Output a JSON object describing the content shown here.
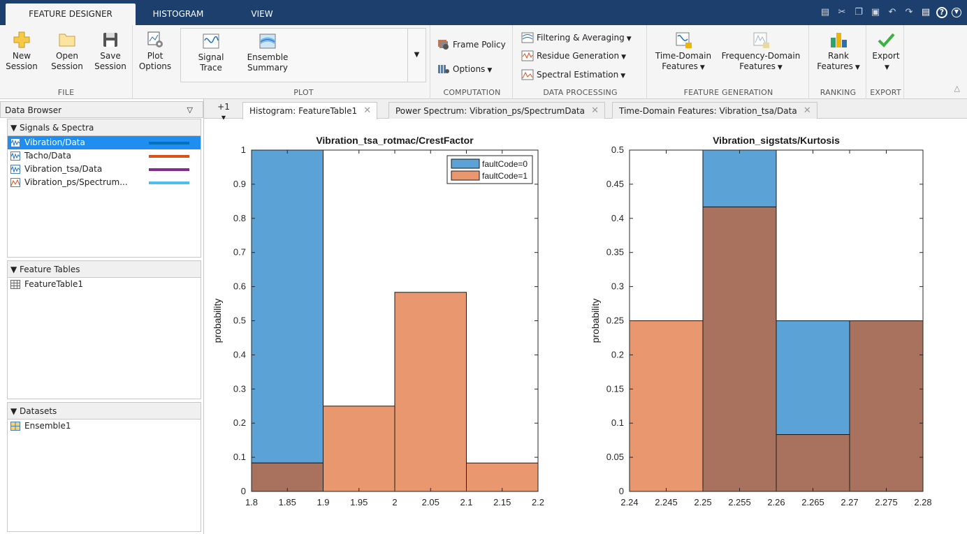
{
  "tabs": [
    {
      "label": "FEATURE DESIGNER",
      "active": true
    },
    {
      "label": "HISTOGRAM",
      "active": false
    },
    {
      "label": "VIEW",
      "active": false
    }
  ],
  "quick_access": [
    "save-icon",
    "cut-icon",
    "copy-icon",
    "paste-icon",
    "undo-icon",
    "redo-icon",
    "layout-icon",
    "help-icon",
    "expand-icon"
  ],
  "ribbon": {
    "file": {
      "name": "FILE",
      "new": [
        "New",
        "Session"
      ],
      "open": [
        "Open",
        "Session"
      ],
      "save": [
        "Save",
        "Session"
      ]
    },
    "plot_options": [
      "Plot",
      "Options"
    ],
    "plot": {
      "name": "PLOT",
      "signal_trace": [
        "Signal",
        "Trace"
      ],
      "ensemble_summary": [
        "Ensemble",
        "Summary"
      ]
    },
    "computation": {
      "name": "COMPUTATION",
      "frame_policy": "Frame Policy",
      "options": "Options"
    },
    "data_processing": {
      "name": "DATA PROCESSING",
      "filtering": "Filtering & Averaging",
      "residue": "Residue Generation",
      "spectral": "Spectral Estimation"
    },
    "feature_generation": {
      "name": "FEATURE GENERATION",
      "time_domain": [
        "Time-Domain",
        "Features"
      ],
      "freq_domain": [
        "Frequency-Domain",
        "Features"
      ]
    },
    "ranking": {
      "name": "RANKING",
      "rank": [
        "Rank",
        "Features"
      ]
    },
    "export": {
      "name": "EXPORT",
      "export": "Export"
    }
  },
  "data_browser": {
    "title": "Data Browser",
    "signals_header": "Signals & Spectra",
    "signals": [
      {
        "label": "Vibration/Data",
        "color": "#0072bd",
        "selected": true
      },
      {
        "label": "Tacho/Data",
        "color": "#d95319",
        "selected": false
      },
      {
        "label": "Vibration_tsa/Data",
        "color": "#7e2f8e",
        "selected": false
      },
      {
        "label": "Vibration_ps/Spectrum...",
        "color": "#4dbeee",
        "selected": false
      }
    ],
    "feature_tables_header": "Feature Tables",
    "feature_tables": [
      "FeatureTable1"
    ],
    "datasets_header": "Datasets",
    "datasets": [
      "Ensemble1"
    ]
  },
  "doc_tabs": {
    "plus_label": "+1",
    "items": [
      {
        "label": "Histogram: FeatureTable1",
        "active": true
      },
      {
        "label": "Power Spectrum: Vibration_ps/SpectrumData",
        "active": false
      },
      {
        "label": "Time-Domain Features: Vibration_tsa/Data",
        "active": false
      }
    ]
  },
  "colors": {
    "fault0": "#5ba3d6",
    "fault1": "#e8976f",
    "overlap": "#a8725e"
  },
  "chart_data": [
    {
      "type": "bar",
      "title": "Vibration_tsa_rotmac/CrestFactor",
      "xlabel": "",
      "ylabel": "probability",
      "xlim": [
        1.8,
        2.2
      ],
      "ylim": [
        0,
        1
      ],
      "xticks": [
        "1.8",
        "1.85",
        "1.9",
        "1.95",
        "2",
        "2.05",
        "2.1",
        "2.15",
        "2.2"
      ],
      "yticks": [
        "0",
        "0.1",
        "0.2",
        "0.3",
        "0.4",
        "0.5",
        "0.6",
        "0.7",
        "0.8",
        "0.9",
        "1"
      ],
      "bin_edges": [
        1.8,
        1.9,
        2.0,
        2.1,
        2.2
      ],
      "series": [
        {
          "name": "faultCode=0",
          "values": [
            1.0,
            0,
            0,
            0
          ]
        },
        {
          "name": "faultCode=1",
          "values": [
            0.0833,
            0.25,
            0.5833,
            0.0833
          ]
        }
      ],
      "legend": "top-right"
    },
    {
      "type": "bar",
      "title": "Vibration_sigstats/Kurtosis",
      "xlabel": "",
      "ylabel": "probability",
      "xlim": [
        2.24,
        2.28
      ],
      "ylim": [
        0,
        0.5
      ],
      "xticks": [
        "2.24",
        "2.245",
        "2.25",
        "2.255",
        "2.26",
        "2.265",
        "2.27",
        "2.275",
        "2.28"
      ],
      "yticks": [
        "0",
        "0.05",
        "0.1",
        "0.15",
        "0.2",
        "0.25",
        "0.3",
        "0.35",
        "0.4",
        "0.45",
        "0.5"
      ],
      "bin_edges": [
        2.24,
        2.25,
        2.26,
        2.27,
        2.28
      ],
      "series": [
        {
          "name": "faultCode=0",
          "values": [
            0,
            0.5,
            0.25,
            0.25
          ]
        },
        {
          "name": "faultCode=1",
          "values": [
            0.25,
            0.4167,
            0.0833,
            0.25
          ]
        }
      ]
    }
  ]
}
